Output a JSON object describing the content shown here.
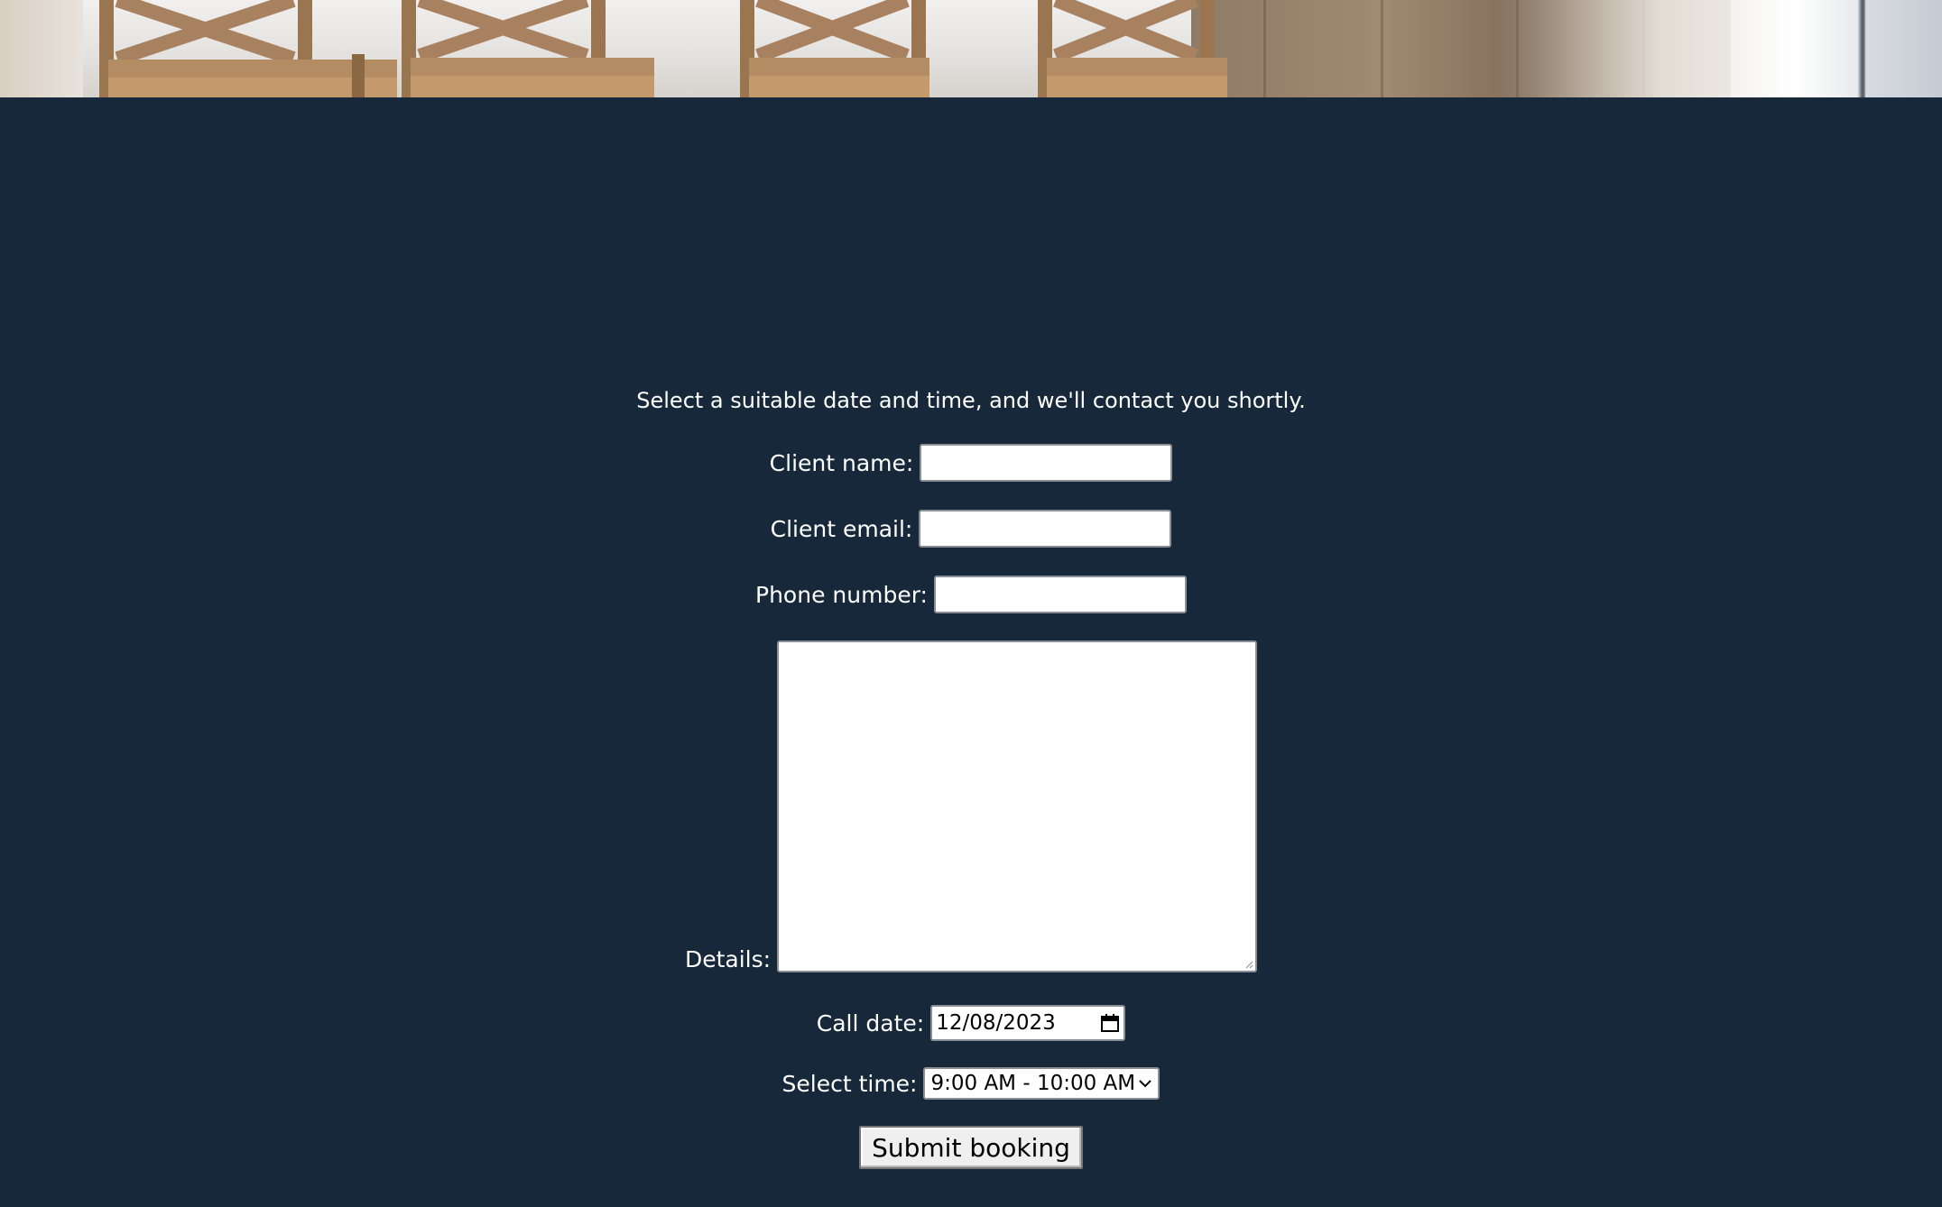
{
  "hero": {
    "description_icon": "dining-chairs-photo"
  },
  "form": {
    "intro": "Select a suitable date and time, and we'll contact you shortly.",
    "client_name_label": "Client name:",
    "client_name_value": "",
    "client_email_label": "Client email:",
    "client_email_value": "",
    "phone_label": "Phone number:",
    "phone_value": "",
    "details_label": "Details:",
    "details_value": "",
    "call_date_label": "Call date:",
    "call_date_value": "12/08/2023",
    "select_time_label": "Select time:",
    "select_time_value": "9:00 AM - 10:00 AM",
    "submit_label": "Submit booking"
  },
  "colors": {
    "background": "#162839",
    "text": "#ffffff",
    "input_bg": "#ffffff",
    "button_bg": "#efefef"
  }
}
